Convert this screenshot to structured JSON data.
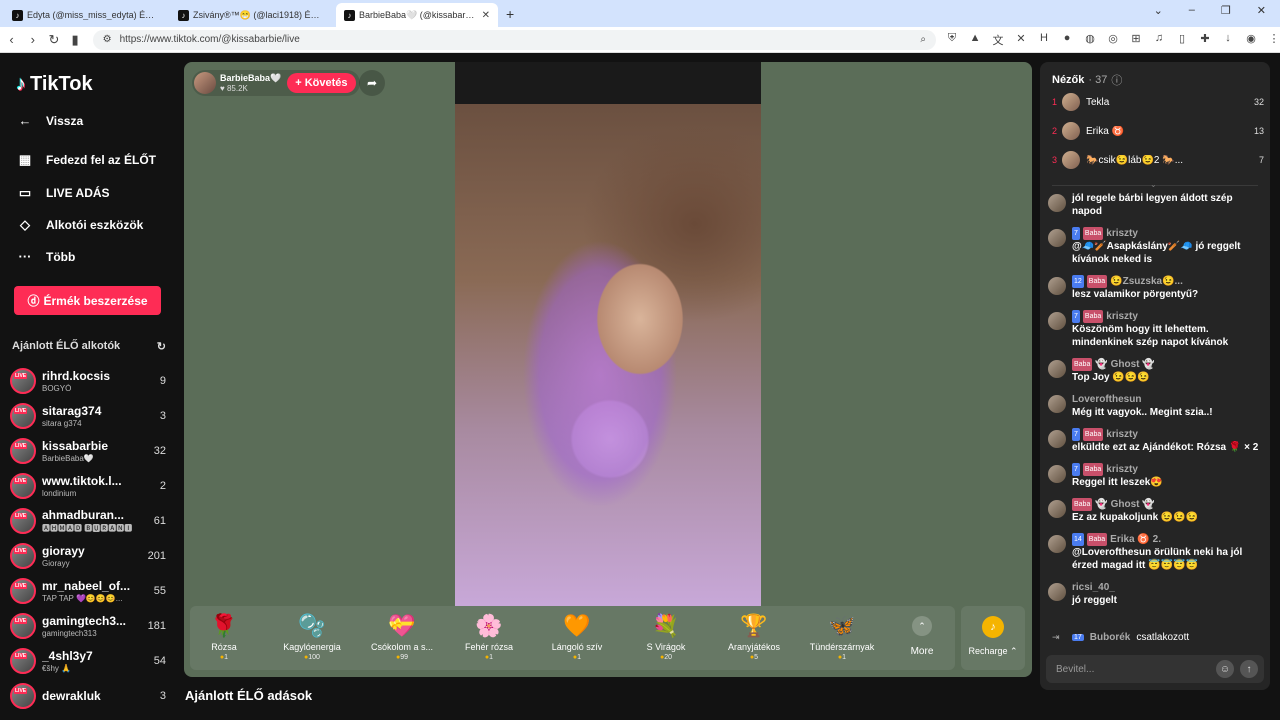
{
  "browser": {
    "tabs": [
      {
        "title": "Edyta (@miss_miss_edyta) ÉLŐ a...",
        "active": false
      },
      {
        "title": "Zsivány®™😁 (@laci1918) ÉLŐ a...",
        "active": false
      },
      {
        "title": "BarbieBaba🤍 (@kissabarbie)...",
        "active": true
      }
    ],
    "new_tab": "+",
    "url": "https://www.tiktok.com/@kissabarbie/live"
  },
  "sidebar": {
    "logo": "TikTok",
    "nav": [
      {
        "label": "Vissza",
        "icon": "←"
      },
      {
        "label": "Fedezd fel az ÉLŐT",
        "icon": "▦"
      },
      {
        "label": "LIVE ADÁS",
        "icon": "▭"
      },
      {
        "label": "Alkotói eszközök",
        "icon": "◇"
      },
      {
        "label": "Több",
        "icon": "···"
      }
    ],
    "coins_button": "Érmék beszerzése",
    "recommended_header": "Ajánlott ÉLŐ alkotók",
    "live_badge": "LIVE",
    "creators": [
      {
        "name": "rihrd.kocsis",
        "sub": "BOGYÓ",
        "count": "9"
      },
      {
        "name": "sitarag374",
        "sub": "sitara g374",
        "count": "3"
      },
      {
        "name": "kissabarbie",
        "sub": "BarbieBaba🤍",
        "count": "32"
      },
      {
        "name": "www.tiktok.l...",
        "sub": "londinium",
        "count": "2"
      },
      {
        "name": "ahmadburan...",
        "sub": "🅰🅷🅼🅰🅳 🅱🆄🆁🅰🅽🅸",
        "count": "61"
      },
      {
        "name": "giorayy",
        "sub": "Giorayy",
        "count": "201"
      },
      {
        "name": "mr_nabeel_of...",
        "sub": "TAP TAP 💜😊😊😊...",
        "count": "55"
      },
      {
        "name": "gamingtech3...",
        "sub": "gamingtech313",
        "count": "181"
      },
      {
        "name": "_4shl3y7",
        "sub": "€šhy 🙏",
        "count": "54"
      },
      {
        "name": "dewrakluk",
        "sub": "",
        "count": "3"
      }
    ]
  },
  "stream": {
    "streamer_name": "BarbieBaba🤍",
    "likes": "♥ 85.2K",
    "follow": "+ Követés",
    "gifts": [
      {
        "icon": "🌹",
        "name": "Rózsa",
        "price": "1"
      },
      {
        "icon": "🫧",
        "name": "Kagylóenergia",
        "price": "100"
      },
      {
        "icon": "💝",
        "name": "Csókolom a s...",
        "price": "99"
      },
      {
        "icon": "🌸",
        "name": "Fehér rózsa",
        "price": "1"
      },
      {
        "icon": "🧡",
        "name": "Lángoló szív",
        "price": "1"
      },
      {
        "icon": "💐",
        "name": "S Virágok",
        "price": "20"
      },
      {
        "icon": "🏆",
        "name": "Aranyjátékos",
        "price": "5"
      },
      {
        "icon": "🦋",
        "name": "Tündérszárnyak",
        "price": "1"
      }
    ],
    "more": "More",
    "recharge": "Recharge ⌃",
    "section_title": "Ajánlott ÉLŐ adások"
  },
  "viewers": {
    "title": "Nézők",
    "count": "· 37",
    "top": [
      {
        "rank": "1",
        "name": "Tekla",
        "score": "32"
      },
      {
        "rank": "2",
        "name": "Erika ♉",
        "score": "13"
      },
      {
        "rank": "3",
        "name": "🐎csik😉láb😉2 🐎...",
        "score": "7"
      }
    ]
  },
  "chat": {
    "messages": [
      {
        "user": "",
        "level": "",
        "badge": "",
        "text": "jól regele bárbi legyen áldott szép napod"
      },
      {
        "user": "kriszty",
        "level": "7",
        "badge": "Baba",
        "text": "@🧢🏏Asapkáslány🏏🧢 jó reggelt kívánok neked is"
      },
      {
        "user": "😉Zsuzska😉...",
        "level": "12",
        "badge": "Baba",
        "text": "lesz valamikor pörgentyű?"
      },
      {
        "user": "kriszty",
        "level": "7",
        "badge": "Baba",
        "text": "Köszönöm hogy itt lehettem. mindenkinek szép napot kívánok"
      },
      {
        "user": "👻 Ghost 👻",
        "level": "",
        "badge": "Baba",
        "text": "Top Joy 😉😉😉"
      },
      {
        "user": "Loverofthesun",
        "level": "",
        "badge": "",
        "text": "Még itt vagyok.. Megint szia..!"
      },
      {
        "user": "kriszty",
        "level": "7",
        "badge": "Baba",
        "text": "elküldte ezt az Ajándékot: Rózsa 🌹 × 2"
      },
      {
        "user": "kriszty",
        "level": "7",
        "badge": "Baba",
        "text": "Reggel itt leszek😍"
      },
      {
        "user": "👻 Ghost 👻",
        "level": "",
        "badge": "Baba",
        "text": "Ez az kupakoljunk 😉😉😉"
      },
      {
        "user": "Erika ♉ 2.",
        "level": "14",
        "badge": "Baba",
        "text": "@Loverofthesun örülünk neki ha jól érzed magad itt 😇😇😇😇"
      },
      {
        "user": "ricsi_40_",
        "level": "",
        "badge": "",
        "text": "jó reggelt"
      }
    ],
    "joined_level": "17",
    "joined_user": "Buborék",
    "joined_text": "csatlakozott",
    "input_placeholder": "Bevitel..."
  }
}
